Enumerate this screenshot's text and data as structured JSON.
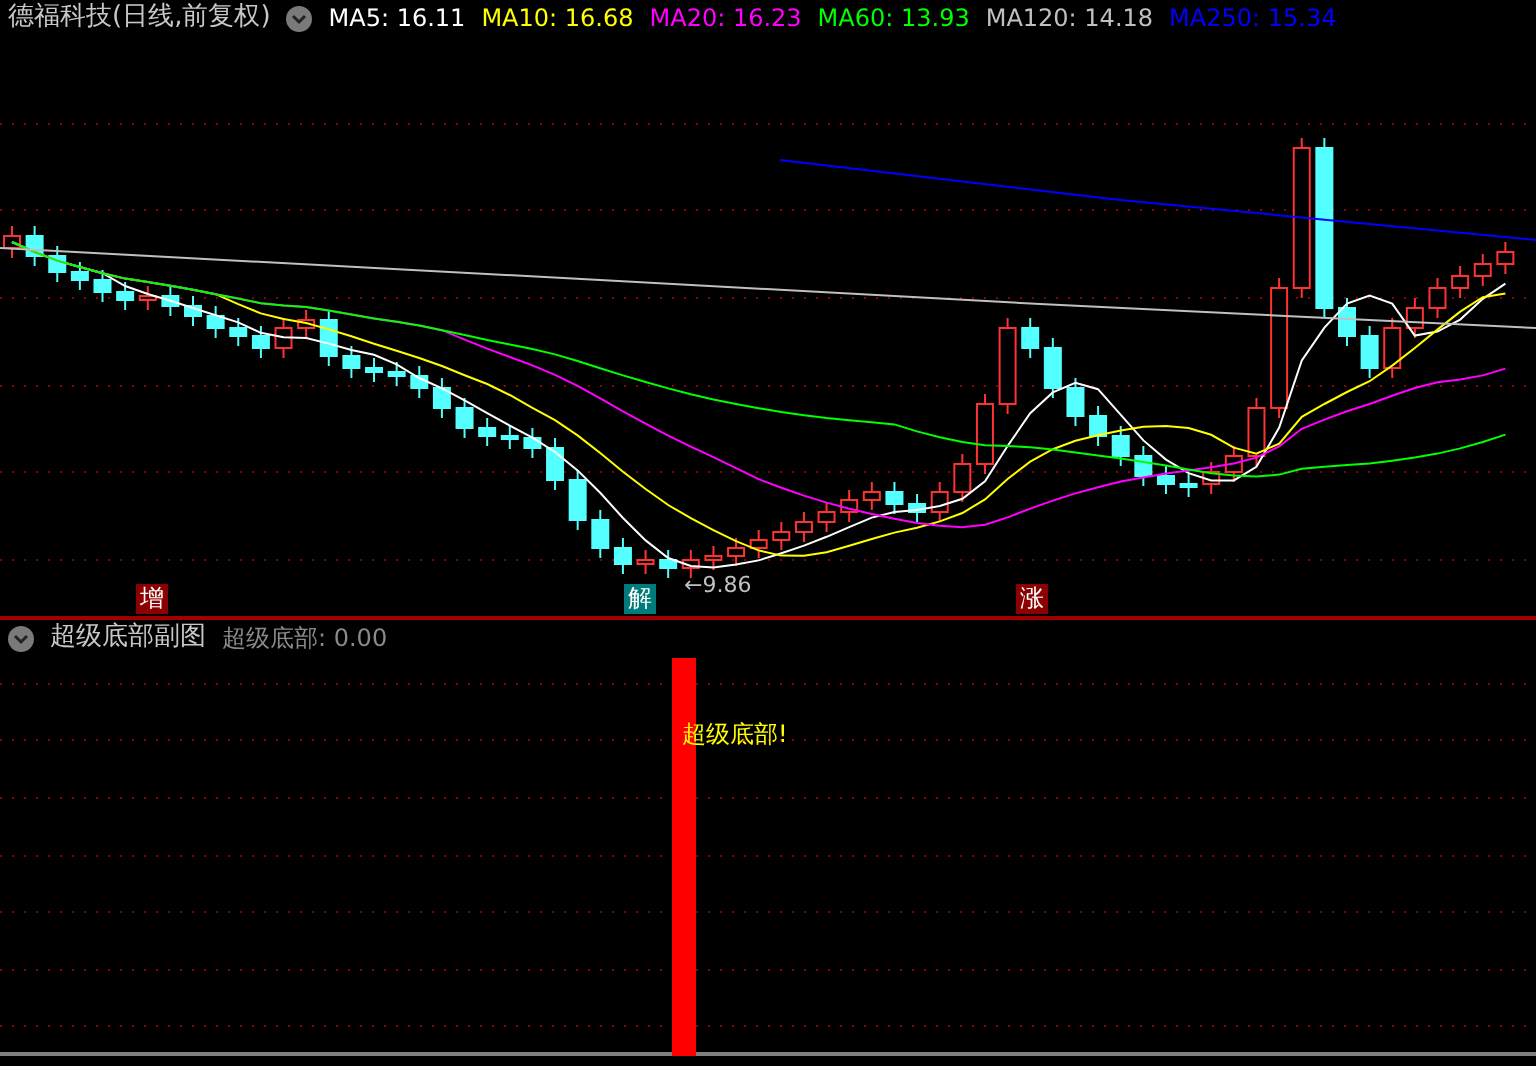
{
  "main_chart": {
    "title": "德福科技(日线,前复权)",
    "moving_averages": [
      {
        "label": "MA5: 16.11",
        "color": "#ffffff"
      },
      {
        "label": "MA10: 16.68",
        "color": "#ffff00"
      },
      {
        "label": "MA20: 16.23",
        "color": "#ff00ff"
      },
      {
        "label": "MA60: 13.93",
        "color": "#00ff00"
      },
      {
        "label": "MA120: 14.18",
        "color": "#c0c0c0"
      },
      {
        "label": "MA250: 15.34",
        "color": "#0000ff"
      }
    ],
    "markers": [
      {
        "text": "增",
        "color": "#8b0000"
      },
      {
        "text": "解",
        "color": "#007b7b"
      },
      {
        "text": "涨",
        "color": "#8b0000"
      }
    ],
    "low_annotation": "←9.86"
  },
  "sub_chart": {
    "title": "超级底部副图",
    "reading": "超级底部: 0.00",
    "signal_label": "超级底部!"
  }
}
